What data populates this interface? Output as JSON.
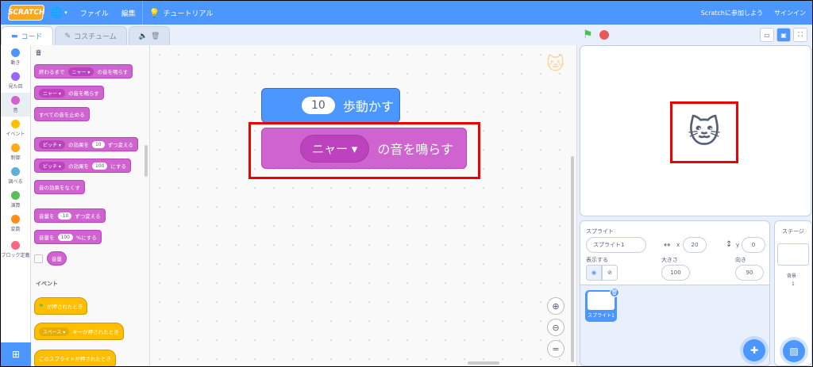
{
  "menubar": {
    "logo": "SCRATCH",
    "file": "ファイル",
    "edit": "編集",
    "tutorials": "チュートリアル",
    "join": "Scratchに参加しよう",
    "signin": "サインイン"
  },
  "tabs": {
    "code": "コード",
    "costumes": "コスチューム"
  },
  "categories": [
    {
      "label": "動き",
      "color": "#4c97ff"
    },
    {
      "label": "見た目",
      "color": "#9966ff"
    },
    {
      "label": "音",
      "color": "#cf63cf"
    },
    {
      "label": "イベント",
      "color": "#ffbf00"
    },
    {
      "label": "制御",
      "color": "#ffab19"
    },
    {
      "label": "調べる",
      "color": "#5cb1d6"
    },
    {
      "label": "演算",
      "color": "#59c059"
    },
    {
      "label": "変数",
      "color": "#ff8c1a"
    },
    {
      "label": "ブロック定義",
      "color": "#ff6680"
    }
  ],
  "palette": {
    "sound_header": "音",
    "play_until_done_a": "終わるまで",
    "play_until_done_b": "の音を鳴らす",
    "sound_name": "ニャー",
    "start_sound": "の音を鳴らす",
    "stop_all": "すべての音を止める",
    "effect_name": "ピッチ",
    "change_effect_a": "の効果を",
    "change_effect_val": "10",
    "change_effect_b": "ずつ変える",
    "set_effect_a": "の効果を",
    "set_effect_val": "100",
    "set_effect_b": "にする",
    "clear_effects": "音の効果をなくす",
    "change_volume_a": "音量を",
    "change_volume_val": "-10",
    "change_volume_b": "ずつ変える",
    "set_volume_a": "音量を",
    "set_volume_val": "100",
    "set_volume_b": "%にする",
    "volume_reporter": "音量",
    "events_header": "イベント",
    "when_flag": "が押されたとき",
    "key_name": "スペース",
    "when_key": "キーが押されたとき",
    "when_sprite_clicked": "このスプライトが押されたとき"
  },
  "workspace": {
    "move_value": "10",
    "move_label": "歩動かす",
    "sound_select": "ニャー",
    "sound_label": "の音を鳴らす"
  },
  "sprite_info": {
    "sprite_label": "スプライト",
    "sprite_name": "スプライト1",
    "x_label": "x",
    "x_value": "20",
    "y_label": "y",
    "y_value": "0",
    "show_label": "表示する",
    "size_label": "大きさ",
    "size_value": "100",
    "direction_label": "向き",
    "direction_value": "90",
    "thumb_name": "スプライト1"
  },
  "stage_pane": {
    "label": "ステージ",
    "backdrops_label": "背景",
    "backdrops_count": "1"
  },
  "colors": {
    "accent": "#4c97ff",
    "highlight": "#ee0000"
  }
}
